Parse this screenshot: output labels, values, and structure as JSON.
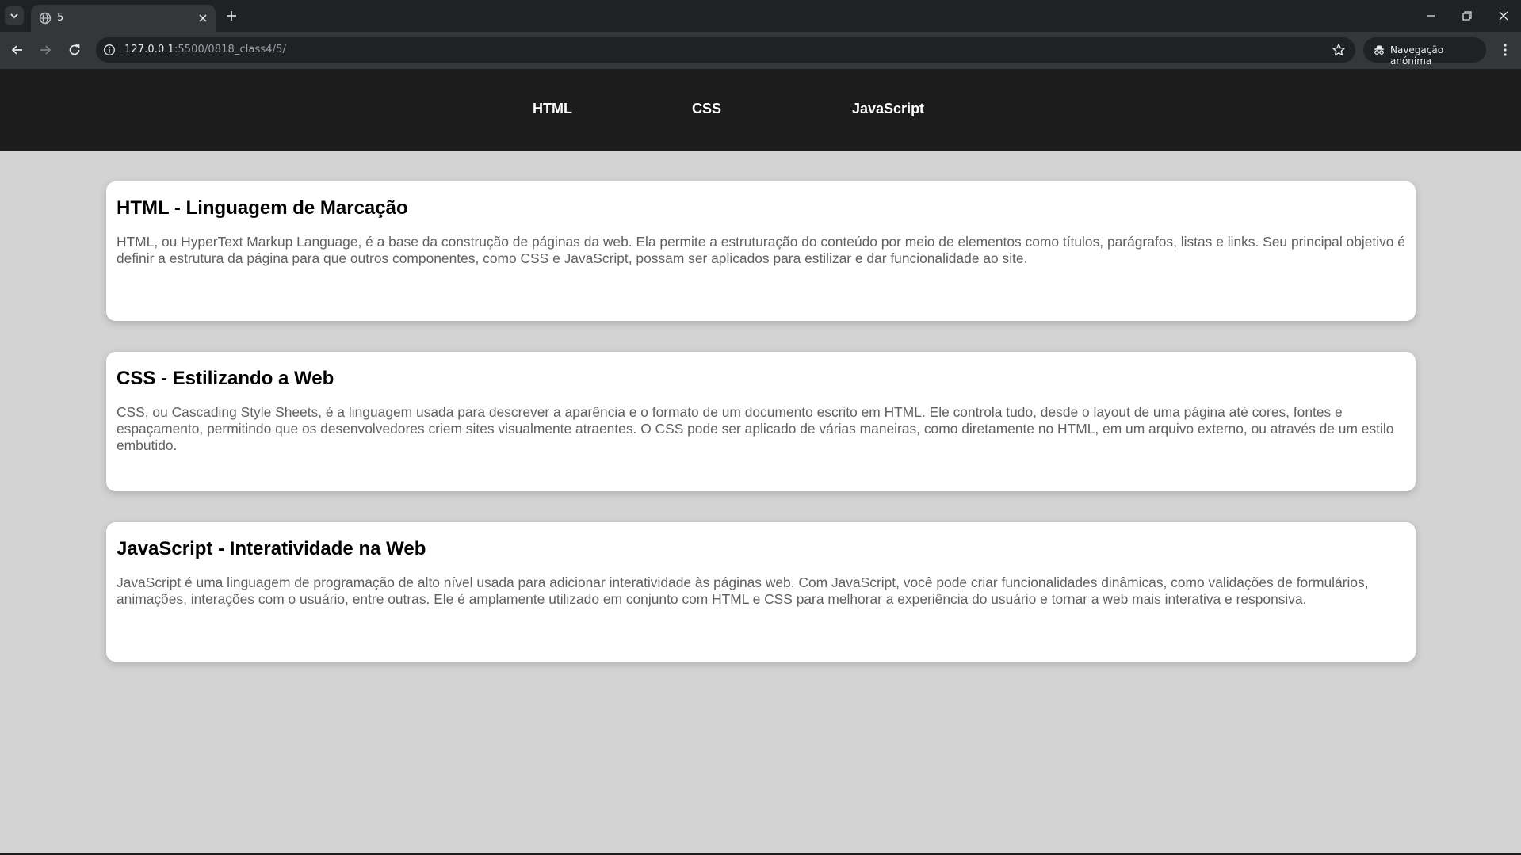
{
  "browser": {
    "tab": {
      "title": "5"
    },
    "url": {
      "host": "127.0.0.1",
      "rest": ":5500/0818_class4/5/"
    },
    "incognito_label": "Navegação anónima"
  },
  "nav": {
    "items": [
      "HTML",
      "CSS",
      "JavaScript"
    ]
  },
  "sections": [
    {
      "title": "HTML - Linguagem de Marcação",
      "text": "HTML, ou HyperText Markup Language, é a base da construção de páginas da web. Ela permite a estruturação do conteúdo por meio de elementos como títulos, parágrafos, listas e links. Seu principal objetivo é definir a estrutura da página para que outros componentes, como CSS e JavaScript, possam ser aplicados para estilizar e dar funcionalidade ao site."
    },
    {
      "title": "CSS - Estilizando a Web",
      "text": "CSS, ou Cascading Style Sheets, é a linguagem usada para descrever a aparência e o formato de um documento escrito em HTML. Ele controla tudo, desde o layout de uma página até cores, fontes e espaçamento, permitindo que os desenvolvedores criem sites visualmente atraentes. O CSS pode ser aplicado de várias maneiras, como diretamente no HTML, em um arquivo externo, ou através de um estilo embutido."
    },
    {
      "title": "JavaScript - Interatividade na Web",
      "text": "JavaScript é uma linguagem de programação de alto nível usada para adicionar interatividade às páginas web. Com JavaScript, você pode criar funcionalidades dinâmicas, como validações de formulários, animações, interações com o usuário, entre outras. Ele é amplamente utilizado em conjunto com HTML e CSS para melhorar a experiência do usuário e tornar a web mais interativa e responsiva."
    }
  ],
  "colors": {
    "page_bg": "#d3d3d3",
    "nav_bg": "#1c1c1c",
    "card_bg": "#ffffff",
    "body_text": "#616161"
  }
}
